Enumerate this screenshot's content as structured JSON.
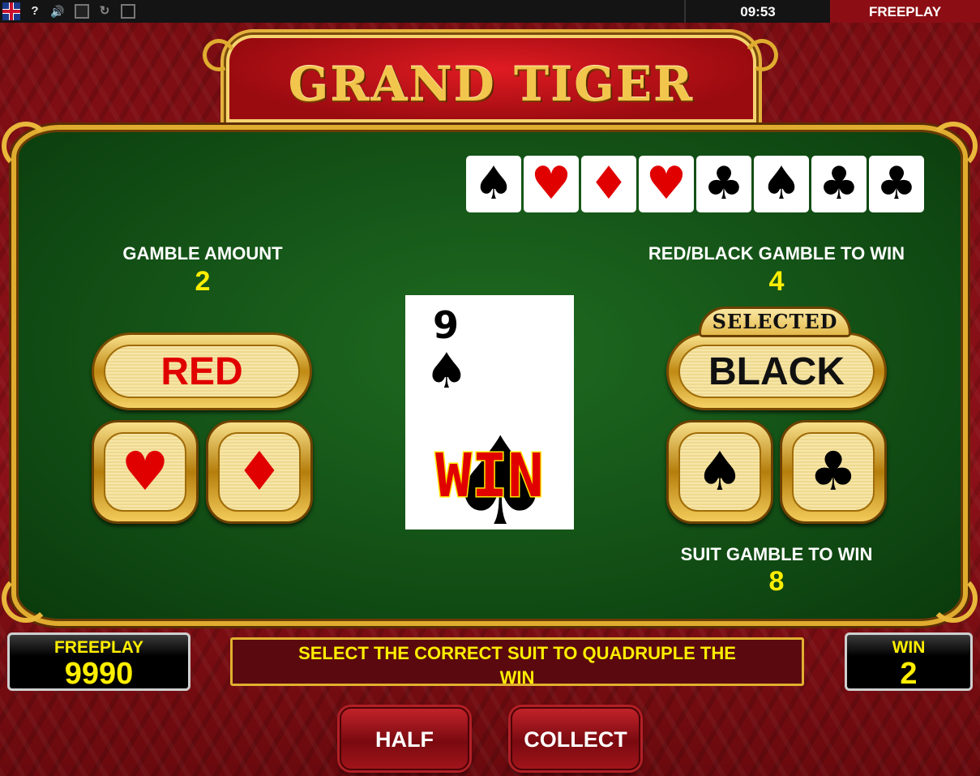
{
  "topbar": {
    "icons": [
      "flag-icon",
      "help-icon",
      "sound-icon",
      "stop-icon",
      "reload-icon",
      "fullscreen-icon"
    ],
    "help_glyph": "?",
    "sound_glyph": "🔊",
    "reload_glyph": "↻",
    "clock": "09:53",
    "mode": "FREEPLAY"
  },
  "title": "GRAND TIGER",
  "history": [
    {
      "suit": "♠",
      "color": "black"
    },
    {
      "suit": "♥",
      "color": "red"
    },
    {
      "suit": "♦",
      "color": "red"
    },
    {
      "suit": "♥",
      "color": "red"
    },
    {
      "suit": "♣",
      "color": "black"
    },
    {
      "suit": "♠",
      "color": "black"
    },
    {
      "suit": "♣",
      "color": "black"
    },
    {
      "suit": "♣",
      "color": "black"
    }
  ],
  "gamble_amount": {
    "label": "GAMBLE AMOUNT",
    "value": "2"
  },
  "red_black": {
    "label": "RED/BLACK GAMBLE TO WIN",
    "value": "4"
  },
  "suit_gamble": {
    "label": "SUIT GAMBLE TO WIN",
    "value": "8"
  },
  "buttons": {
    "red": "RED",
    "black": "BLACK",
    "selected": "SELECTED",
    "hearts": "♥",
    "diamonds": "♦",
    "spades": "♠",
    "clubs": "♣",
    "half": "HALF",
    "collect": "COLLECT"
  },
  "drawn_card": {
    "rank": "9",
    "suit": "♠",
    "result": "WIN"
  },
  "balance": {
    "label": "FREEPLAY",
    "value": "9990"
  },
  "win": {
    "label": "WIN",
    "value": "2"
  },
  "message": "SELECT THE CORRECT SUIT TO QUADRUPLE THE WIN",
  "colors": {
    "red": "#e10000",
    "black": "#000000",
    "accent_gold": "#e0ac2f",
    "value_yellow": "#ffee00"
  }
}
